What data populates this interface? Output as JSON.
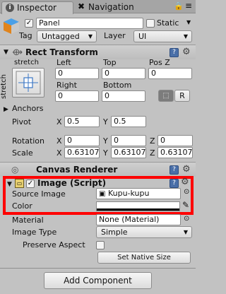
{
  "tabs": {
    "inspector": "Inspector",
    "navigation": "Navigation"
  },
  "go": {
    "name": "Panel",
    "static_label": "Static",
    "tag_label": "Tag",
    "tag_value": "Untagged",
    "layer_label": "Layer",
    "layer_value": "UI"
  },
  "rect": {
    "title": "Rect Transform",
    "anchor_h": "stretch",
    "anchor_v": "stretch",
    "left_label": "Left",
    "top_label": "Top",
    "posz_label": "Pos Z",
    "left": "0",
    "top": "0",
    "posz": "0",
    "right_label": "Right",
    "bottom_label": "Bottom",
    "right": "0",
    "bottom": "0",
    "r_button": "R",
    "anchors_label": "Anchors",
    "pivot_label": "Pivot",
    "pivot_x": "0.5",
    "pivot_y": "0.5",
    "rotation_label": "Rotation",
    "rot_x": "0",
    "rot_y": "0",
    "rot_z": "0",
    "scale_label": "Scale",
    "scale_x": "0.63107",
    "scale_y": "0.63107",
    "scale_z": "0.63107",
    "axis_x": "X",
    "axis_y": "Y",
    "axis_z": "Z"
  },
  "canvas_renderer": {
    "title": "Canvas Renderer"
  },
  "image": {
    "title": "Image (Script)",
    "source_label": "Source Image",
    "source_value": "Kupu-kupu",
    "color_label": "Color",
    "color_value": "#ffffff",
    "material_label": "Material",
    "material_value": "None (Material)",
    "image_type_label": "Image Type",
    "image_type_value": "Simple",
    "preserve_label": "Preserve Aspect",
    "native_button": "Set Native Size"
  },
  "add_component": "Add Component",
  "highlight_color": "#ff0000"
}
